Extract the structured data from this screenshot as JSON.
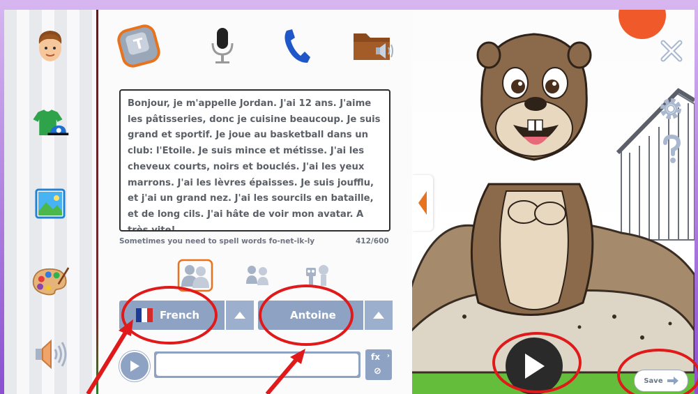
{
  "editor": {
    "speech_text": "Bonjour, je m'appelle Jordan. J'ai 12 ans. J'aime les pâtisseries, donc je cuisine beaucoup. Je suis grand et sportif. Je joue au basketball dans un club: l'Etoile. Je suis mince et métisse. J'ai les cheveux courts, noirs et bouclés. J'ai les yeux marrons. J'ai les lèvres épaisses. Je suis joufflu, et j'ai un grand nez. J'ai les sourcils en bataille, et de long cils. J'ai hâte de voir mon avatar. A très vite!",
    "hint": "Sometimes you need to spell words fo-net-ik-ly",
    "char_count": "412/600",
    "language_label": "French",
    "voice_label": "Antoine",
    "entry_value": "",
    "fx_label": "fx"
  },
  "scene": {
    "save_label": "Save"
  },
  "colors": {
    "accent": "#e8731e",
    "panel_blue": "#8ea3c3",
    "annotation_red": "#e01a1a"
  },
  "icons": [
    "face-icon",
    "clothes-icon",
    "background-icon",
    "palette-icon",
    "speaker-icon",
    "keyboard-icon",
    "microphone-icon",
    "phone-icon",
    "folder-audio-icon",
    "group-icon",
    "kids-icon",
    "robots-icon",
    "close-icon",
    "settings-icon",
    "help-icon",
    "play-icon"
  ]
}
